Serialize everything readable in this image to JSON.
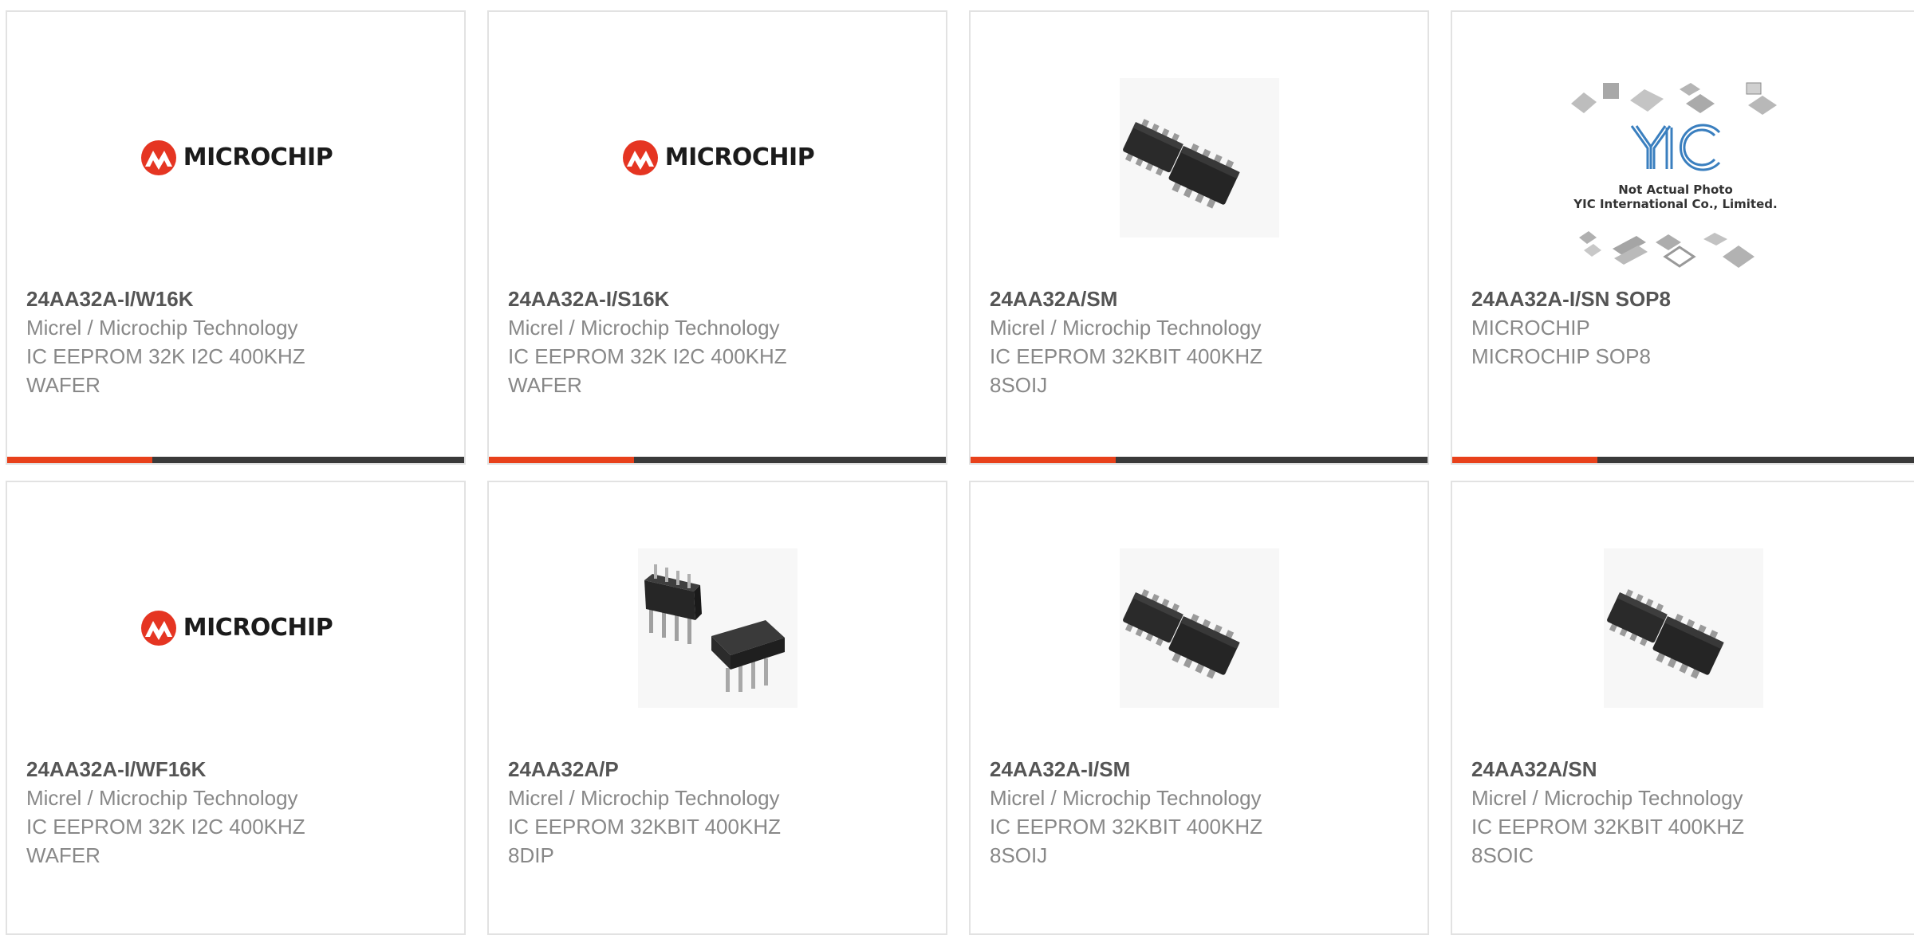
{
  "cards": [
    {
      "image": "microchip-logo",
      "logo_text": "MICROCHIP",
      "part_number": "24AA32A-I/W16K",
      "manufacturer": "Micrel / Microchip Technology",
      "desc1": "IC EEPROM 32K I2C 400KHZ",
      "desc2": "WAFER"
    },
    {
      "image": "microchip-logo",
      "logo_text": "MICROCHIP",
      "part_number": "24AA32A-I/S16K",
      "manufacturer": "Micrel / Microchip Technology",
      "desc1": "IC EEPROM 32K I2C 400KHZ",
      "desc2": "WAFER"
    },
    {
      "image": "soic-chips-photo",
      "part_number": "24AA32A/SM",
      "manufacturer": "Micrel / Microchip Technology",
      "desc1": "IC EEPROM 32KBIT 400KHZ",
      "desc2": "8SOIJ"
    },
    {
      "image": "yic-not-actual-photo",
      "yic_logo": "YIC",
      "yic_line1": "Not Actual Photo",
      "yic_line2": "YIC International Co., Limited.",
      "part_number": "24AA32A-I/SN SOP8",
      "manufacturer": "MICROCHIP",
      "desc1": "MICROCHIP SOP8",
      "desc2": ""
    },
    {
      "image": "microchip-logo",
      "logo_text": "MICROCHIP",
      "part_number": "24AA32A-I/WF16K",
      "manufacturer": "Micrel / Microchip Technology",
      "desc1": "IC EEPROM 32K I2C 400KHZ",
      "desc2": "WAFER"
    },
    {
      "image": "dip-chips-photo",
      "part_number": "24AA32A/P",
      "manufacturer": "Micrel / Microchip Technology",
      "desc1": "IC EEPROM 32KBIT 400KHZ",
      "desc2": "8DIP"
    },
    {
      "image": "soic-chips-photo",
      "part_number": "24AA32A-I/SM",
      "manufacturer": "Micrel / Microchip Technology",
      "desc1": "IC EEPROM 32KBIT 400KHZ",
      "desc2": "8SOIJ"
    },
    {
      "image": "soic-chips-photo",
      "part_number": "24AA32A/SN",
      "manufacturer": "Micrel / Microchip Technology",
      "desc1": "IC EEPROM 32KBIT 400KHZ",
      "desc2": "8SOIC"
    }
  ],
  "colors": {
    "accent": "#e8411b",
    "bar": "#3a3a3a",
    "border": "#e2e2e2",
    "text_muted": "#888888",
    "text_strong": "#555555",
    "logo_red": "#e53522"
  }
}
